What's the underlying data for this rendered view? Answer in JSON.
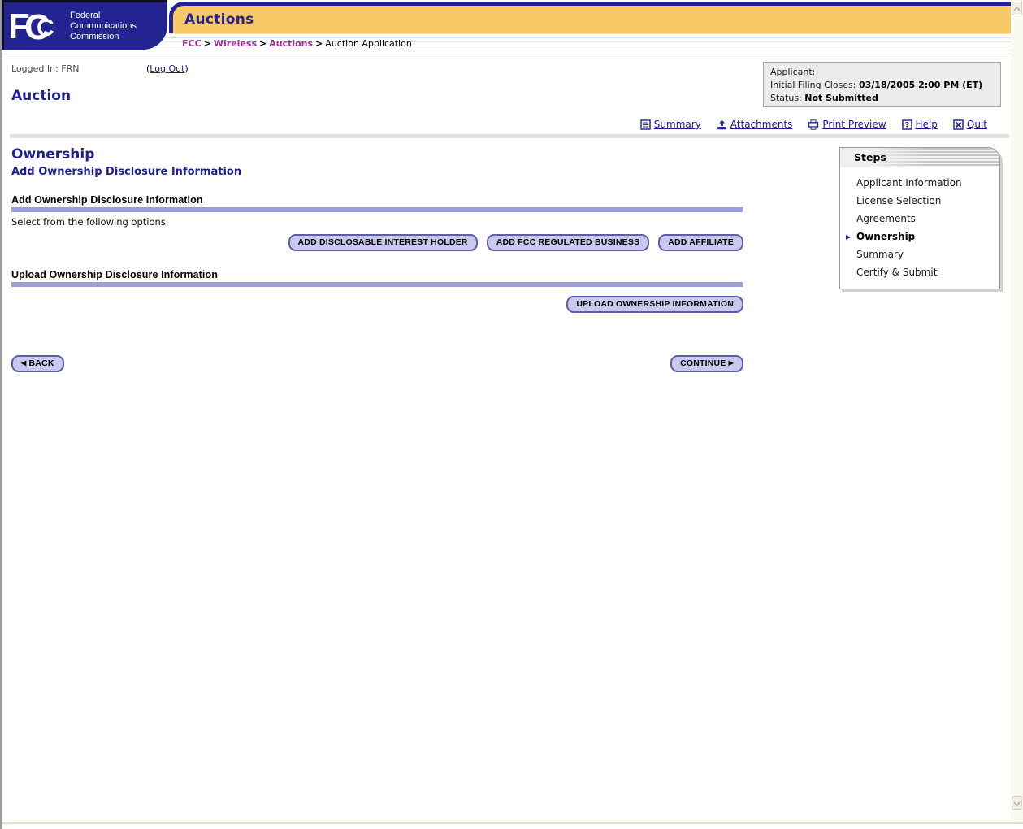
{
  "header": {
    "logo": {
      "acronym": "FCC",
      "org_line1": "Federal",
      "org_line2": "Communications",
      "org_line3": "Commission"
    },
    "app_title": "Auctions",
    "breadcrumb": {
      "link1": "FCC",
      "link2": "Wireless",
      "link3": "Auctions",
      "separator": ">",
      "current": "Auction Application"
    }
  },
  "session": {
    "logged_in": "Logged In: FRN",
    "logout_prefix": "(",
    "logout_label": "Log Out",
    "logout_suffix": ")"
  },
  "page_title": "Auction",
  "applicant_box": {
    "line1_label": "Applicant:",
    "line2_label": "Initial Filing Closes:",
    "line2_value": "03/18/2005 2:00 PM (ET)",
    "line3_label": "Status:",
    "line3_value": "Not Submitted"
  },
  "toolbar": {
    "items": [
      {
        "icon": "summary-icon",
        "label": "Summary"
      },
      {
        "icon": "attachments-icon",
        "label": "Attachments"
      },
      {
        "icon": "print-preview-icon",
        "label": "Print Preview"
      },
      {
        "icon": "help-icon",
        "label": "Help"
      },
      {
        "icon": "quit-icon",
        "label": "Quit"
      }
    ]
  },
  "content": {
    "section_title": "Ownership",
    "section_subtitle": "Add Ownership Disclosure Information",
    "add_section": {
      "heading": "Add Ownership Disclosure Information",
      "instruction": "Select from the following options.",
      "buttons": [
        "ADD DISCLOSABLE INTEREST HOLDER",
        "ADD FCC REGULATED BUSINESS",
        "ADD AFFILIATE"
      ]
    },
    "upload_section": {
      "heading": "Upload Ownership Disclosure Information",
      "button": "UPLOAD OWNERSHIP INFORMATION"
    },
    "nav": {
      "back": "BACK",
      "continue": "CONTINUE"
    }
  },
  "steps_panel": {
    "title": "Steps",
    "items": [
      {
        "label": "Applicant Information",
        "active": false
      },
      {
        "label": "License Selection",
        "active": false
      },
      {
        "label": "Agreements",
        "active": false
      },
      {
        "label": "Ownership",
        "active": true
      },
      {
        "label": "Summary",
        "active": false
      },
      {
        "label": "Certify & Submit",
        "active": false
      }
    ]
  },
  "icons": {
    "back_arrow": "◀",
    "continue_arrow": "▶",
    "active_step_arrow": "▶"
  },
  "colors": {
    "navy": "#232391",
    "gold": "#f8c967",
    "section_bar": "#9e9ed6",
    "pill_bg": "#c9c9ef",
    "pill_border": "#5c5ca8",
    "link_navy": "#1a1a8c",
    "breadcrumb_link": "#993399"
  }
}
